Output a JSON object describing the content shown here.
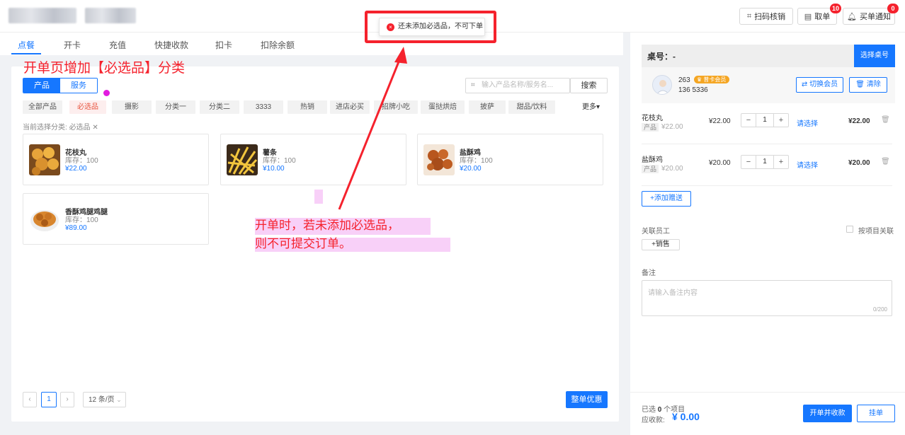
{
  "header": {
    "scan_label": "扫码核销",
    "orders_label": "取单",
    "orders_badge": "10",
    "notify_label": "买单通知",
    "notify_badge": "0"
  },
  "tabs": [
    {
      "label": "点餐"
    },
    {
      "label": "开卡"
    },
    {
      "label": "充值"
    },
    {
      "label": "快捷收款"
    },
    {
      "label": "扣卡"
    },
    {
      "label": "扣除余额"
    }
  ],
  "toast": {
    "message": "还未添加必选品，不可下单"
  },
  "annotations": {
    "title": "开单页增加【必选品】分类",
    "line1": "开单时，若未添加必选品，",
    "line2": "则不可提交订单。"
  },
  "product_panel": {
    "segment": {
      "products": "产品",
      "services": "服务"
    },
    "search_placeholder": "输入产品名称/服务名...",
    "search_button": "搜索",
    "categories": [
      "全部产品",
      "必选品",
      "摄影",
      "分类一",
      "分类二",
      "3333",
      "热销",
      "进店必买",
      "招牌小吃",
      "蛋挞烘焙",
      "披萨",
      "甜品/饮料"
    ],
    "more_label": "更多",
    "current_category_prefix": "当前选择分类:",
    "current_category": "必选品",
    "products": [
      {
        "name": "花枝丸",
        "stock": "库存：100",
        "price": "¥22.00"
      },
      {
        "name": "薯条",
        "stock": "库存：100",
        "price": "¥10.00"
      },
      {
        "name": "盐酥鸡",
        "stock": "库存：100",
        "price": "¥20.00"
      },
      {
        "name": "香酥鸡腿鸡腿",
        "stock": "库存：100",
        "price": "¥89.00"
      }
    ],
    "pagination": {
      "current": "1",
      "page_size": "12 条/页"
    },
    "discount_button": "整单优惠"
  },
  "order_panel": {
    "table_label": "桌号：-",
    "select_table": "选择桌号",
    "member": {
      "id": "263",
      "level": "普卡会员",
      "phone": "136 5336"
    },
    "switch_member": "切换会员",
    "clear": "清除",
    "items": [
      {
        "name": "花枝丸",
        "tag": "产品",
        "original": "¥22.00",
        "unit_price": "¥22.00",
        "qty": "1",
        "choose": "请选择",
        "total": "¥22.00"
      },
      {
        "name": "盐酥鸡",
        "tag": "产品",
        "original": "¥20.00",
        "unit_price": "¥20.00",
        "qty": "1",
        "choose": "请选择",
        "total": "¥20.00"
      }
    ],
    "add_gift": "+添加赠送",
    "staff_label": "关联员工",
    "by_item_label": "按项目关联",
    "sales_button": "+销售",
    "note_label": "备注",
    "note_placeholder": "请输入备注内容",
    "note_count": "0/200"
  },
  "footer": {
    "selected_prefix": "已选",
    "selected_count": "0",
    "selected_suffix": "个项目",
    "receivable_label": "应收款:",
    "amount": "¥ 0.00",
    "pay_button": "开单并收款",
    "hang_button": "挂单"
  },
  "colors": {
    "accent": "#1677ff",
    "annotation": "#f5222d",
    "marker": "#e21be0"
  }
}
